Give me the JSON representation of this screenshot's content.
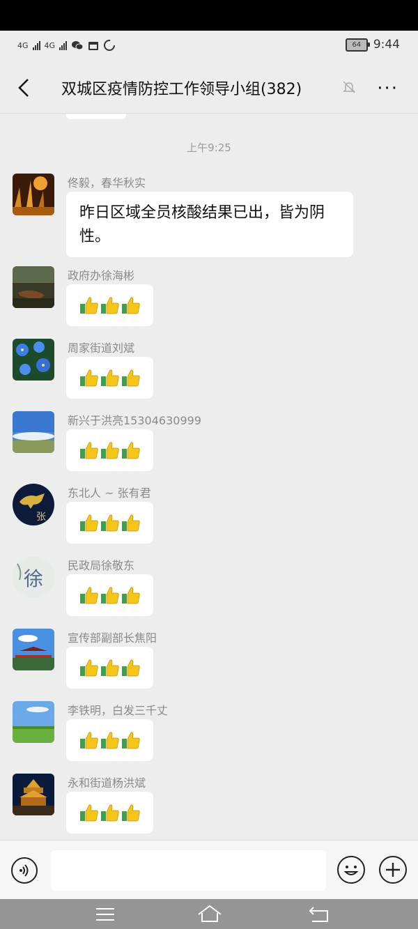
{
  "status_bar": {
    "signal_1": "4G",
    "signal_2": "4G",
    "battery": "64",
    "time": "9:44"
  },
  "header": {
    "back_icon": "chevron-left-icon",
    "title": "双城区疫情防控工作领导小组(382)",
    "mute_icon": "bell-off-icon",
    "more_icon": "more-icon",
    "more_glyph": "···"
  },
  "chat": {
    "timestamp": "上午9:25",
    "messages": [
      {
        "sender": "佟毅，春华秋实",
        "type": "text",
        "text": "昨日区域全员核酸结果已出，皆为阴性。",
        "avatar": "wheat"
      },
      {
        "sender": "政府办徐海彬",
        "type": "emoji",
        "emoji_count": 3,
        "avatar": "boat"
      },
      {
        "sender": "周家街道刘斌",
        "type": "emoji",
        "emoji_count": 3,
        "avatar": "blue-flowers"
      },
      {
        "sender": "新兴于洪亮15304630999",
        "type": "emoji",
        "emoji_count": 3,
        "avatar": "sky"
      },
      {
        "sender": "东北人 ~ 张有君",
        "type": "emoji",
        "emoji_count": 3,
        "avatar": "horse",
        "avatar_text": "张"
      },
      {
        "sender": "民政局徐敬东",
        "type": "emoji",
        "emoji_count": 3,
        "avatar": "calligraphy",
        "avatar_text": "徐"
      },
      {
        "sender": "宣传部副部长焦阳",
        "type": "emoji",
        "emoji_count": 3,
        "avatar": "palace"
      },
      {
        "sender": "李铁明，白发三千丈",
        "type": "emoji",
        "emoji_count": 3,
        "avatar": "field"
      },
      {
        "sender": "永和街道杨洪斌",
        "type": "emoji",
        "emoji_count": 3,
        "avatar": "tower"
      }
    ]
  },
  "input_bar": {
    "voice_icon": "voice-icon",
    "emoji_icon": "smiley-icon",
    "plus_icon": "plus-icon"
  },
  "colors": {
    "background": "#ededed",
    "bubble": "#ffffff",
    "text": "#111111",
    "sender": "#8a8a8a",
    "thumb_yellow": "#f5c518",
    "thumb_green": "#3aa34a"
  }
}
